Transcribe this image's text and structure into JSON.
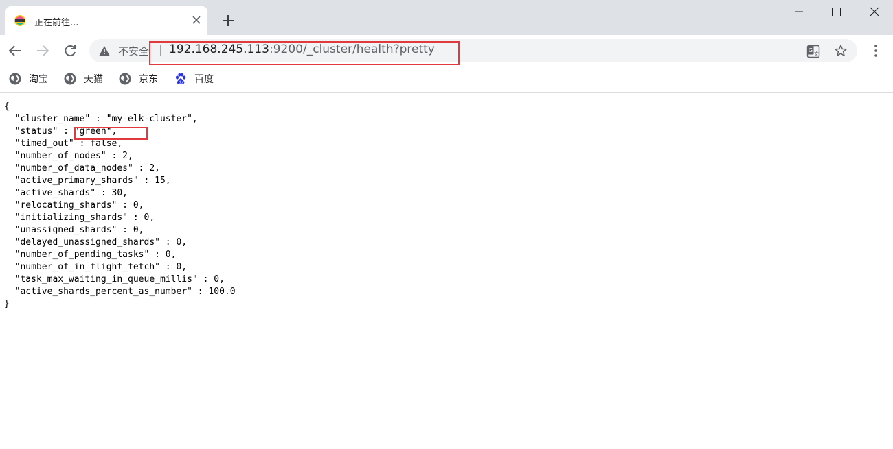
{
  "tab": {
    "title": "正在前往..."
  },
  "window_controls": [
    "minimize",
    "maximize",
    "close"
  ],
  "address_bar": {
    "security_label": "不安全",
    "separator": "|",
    "url_host": "192.168.245.113",
    "url_rest": ":9200/_cluster/health?pretty"
  },
  "bookmarks": [
    {
      "label": "淘宝",
      "icon": "globe-icon"
    },
    {
      "label": "天猫",
      "icon": "globe-icon"
    },
    {
      "label": "京东",
      "icon": "globe-icon"
    },
    {
      "label": "百度",
      "icon": "baidu-paw-icon"
    }
  ],
  "response": {
    "lines": [
      "{",
      "  \"cluster_name\" : \"my-elk-cluster\",",
      "  \"status\" : \"green\",",
      "  \"timed_out\" : false,",
      "  \"number_of_nodes\" : 2,",
      "  \"number_of_data_nodes\" : 2,",
      "  \"active_primary_shards\" : 15,",
      "  \"active_shards\" : 30,",
      "  \"relocating_shards\" : 0,",
      "  \"initializing_shards\" : 0,",
      "  \"unassigned_shards\" : 0,",
      "  \"delayed_unassigned_shards\" : 0,",
      "  \"number_of_pending_tasks\" : 0,",
      "  \"number_of_in_flight_fetch\" : 0,",
      "  \"task_max_waiting_in_queue_millis\" : 0,",
      "  \"active_shards_percent_as_number\" : 100.0",
      "}"
    ]
  },
  "colors": {
    "tabstrip_bg": "#dee1e6",
    "omnibox_bg": "#f1f3f4",
    "highlight_border": "#e0393e"
  }
}
